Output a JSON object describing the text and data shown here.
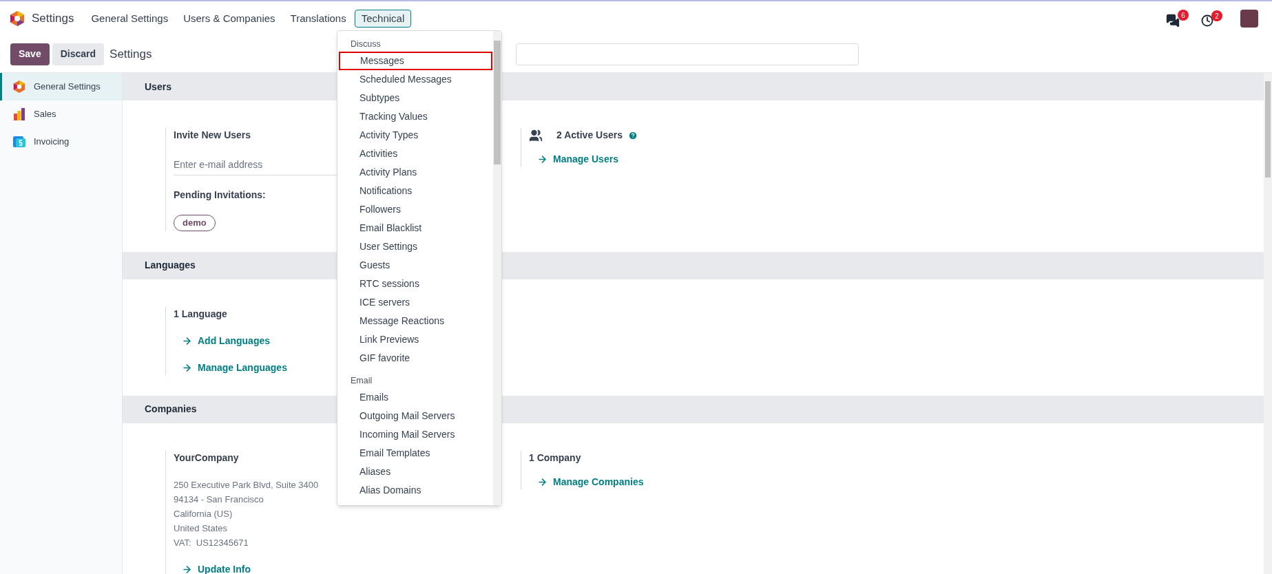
{
  "navbar": {
    "app_title": "Settings",
    "menus": [
      {
        "label": "General Settings",
        "selected": false
      },
      {
        "label": "Users & Companies",
        "selected": false
      },
      {
        "label": "Translations",
        "selected": false
      },
      {
        "label": "Technical",
        "selected": true
      }
    ],
    "notifications": [
      {
        "kind": "messages",
        "count": "6"
      },
      {
        "kind": "activities",
        "count": "2"
      }
    ]
  },
  "control_panel": {
    "buttons": [
      {
        "label": "Save",
        "kind": "primary"
      },
      {
        "label": "Discard",
        "kind": "secondary"
      }
    ],
    "breadcrumb": "Settings"
  },
  "sidebar": {
    "items": [
      {
        "label": "General Settings",
        "selected": true,
        "kind": "settings"
      },
      {
        "label": "Sales",
        "selected": false,
        "kind": "sales"
      },
      {
        "label": "Invoicing",
        "selected": false,
        "kind": "invoicing"
      }
    ]
  },
  "sections": [
    {
      "title": "Users",
      "left": [
        {
          "kind": "title",
          "text": "Invite New Users"
        },
        {
          "kind": "field",
          "placeholder": "Enter e-mail address"
        },
        {
          "kind": "subtitle",
          "text": "Pending Invitations:"
        },
        {
          "kind": "tags",
          "items": [
            "demo"
          ]
        }
      ],
      "right": [
        {
          "kind": "users_title",
          "text": "2 Active Users"
        },
        {
          "kind": "link",
          "text": "Manage Users"
        }
      ]
    },
    {
      "title": "Languages",
      "left": [
        {
          "kind": "title",
          "text": "1 Language"
        },
        {
          "kind": "link",
          "text": "Add Languages"
        },
        {
          "kind": "link",
          "text": "Manage Languages"
        }
      ]
    },
    {
      "title": "Companies",
      "left": [
        {
          "kind": "title",
          "text": "YourCompany"
        },
        {
          "kind": "lines",
          "items": [
            "250 Executive Park Blvd, Suite 3400",
            "94134 - San Francisco",
            "California (US)",
            "United States",
            "VAT:  US12345671"
          ]
        },
        {
          "kind": "link",
          "text": "Update Info"
        }
      ],
      "right": [
        {
          "kind": "title",
          "text": "1 Company"
        },
        {
          "kind": "link",
          "text": "Manage Companies"
        }
      ]
    }
  ],
  "dropdown": {
    "groups": [
      {
        "heading": "Discuss",
        "items": [
          {
            "label": "Messages",
            "selected": true
          },
          {
            "label": "Scheduled Messages",
            "selected": false
          },
          {
            "label": "Subtypes",
            "selected": false
          },
          {
            "label": "Tracking Values",
            "selected": false
          },
          {
            "label": "Activity Types",
            "selected": false
          },
          {
            "label": "Activities",
            "selected": false
          },
          {
            "label": "Activity Plans",
            "selected": false
          },
          {
            "label": "Notifications",
            "selected": false
          },
          {
            "label": "Followers",
            "selected": false
          },
          {
            "label": "Email Blacklist",
            "selected": false
          },
          {
            "label": "User Settings",
            "selected": false
          },
          {
            "label": "Guests",
            "selected": false
          },
          {
            "label": "RTC sessions",
            "selected": false
          },
          {
            "label": "ICE servers",
            "selected": false
          },
          {
            "label": "Message Reactions",
            "selected": false
          },
          {
            "label": "Link Previews",
            "selected": false
          },
          {
            "label": "GIF favorite",
            "selected": false
          }
        ]
      },
      {
        "heading": "Email",
        "items": [
          {
            "label": "Emails",
            "selected": false
          },
          {
            "label": "Outgoing Mail Servers",
            "selected": false
          },
          {
            "label": "Incoming Mail Servers",
            "selected": false
          },
          {
            "label": "Email Templates",
            "selected": false
          },
          {
            "label": "Aliases",
            "selected": false
          },
          {
            "label": "Alias Domains",
            "selected": false
          }
        ]
      }
    ]
  }
}
